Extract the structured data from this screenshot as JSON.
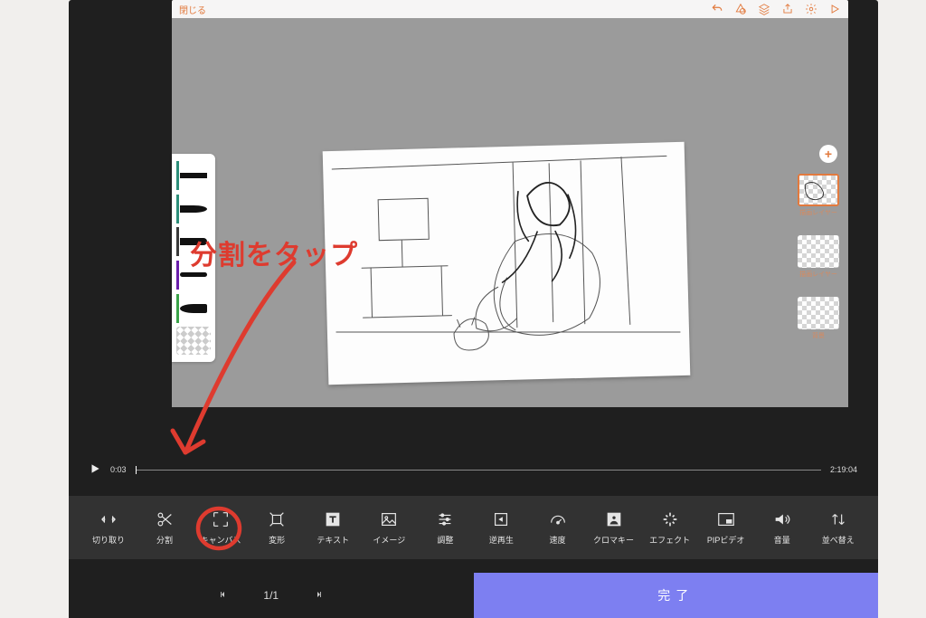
{
  "topbar": {
    "close_label": "閉じる",
    "icons": [
      "undo-icon",
      "shape-icon",
      "layers-icon",
      "share-icon",
      "gear-icon",
      "play-outline-icon"
    ]
  },
  "brush_panel": {
    "accents": [
      "#2d8f7a",
      "#2d8f7a",
      "#3a3a3a",
      "#6a1eab",
      "#3aa349"
    ]
  },
  "layers": {
    "add_label": "+",
    "thumbs": [
      {
        "label": "描画レイヤー",
        "selected": true
      },
      {
        "label": "描画レイヤー",
        "selected": false
      },
      {
        "label": "背景",
        "selected": false
      }
    ]
  },
  "timeline": {
    "current": "0:03",
    "total": "2:19:04"
  },
  "tools": [
    {
      "id": "crop",
      "label": "切り取り"
    },
    {
      "id": "split",
      "label": "分割"
    },
    {
      "id": "canvas",
      "label": "キャンバス"
    },
    {
      "id": "transform",
      "label": "変形"
    },
    {
      "id": "text",
      "label": "テキスト"
    },
    {
      "id": "image",
      "label": "イメージ"
    },
    {
      "id": "adjust",
      "label": "調整"
    },
    {
      "id": "reverse",
      "label": "逆再生"
    },
    {
      "id": "speed",
      "label": "速度"
    },
    {
      "id": "chroma",
      "label": "クロマキー"
    },
    {
      "id": "effect",
      "label": "エフェクト"
    },
    {
      "id": "pip",
      "label": "PIPビデオ"
    },
    {
      "id": "volume",
      "label": "音量"
    },
    {
      "id": "reorder",
      "label": "並べ替え"
    }
  ],
  "pager": {
    "counter": "1/1"
  },
  "done_label": "完了",
  "annotation": {
    "text": "分割をタップ"
  }
}
